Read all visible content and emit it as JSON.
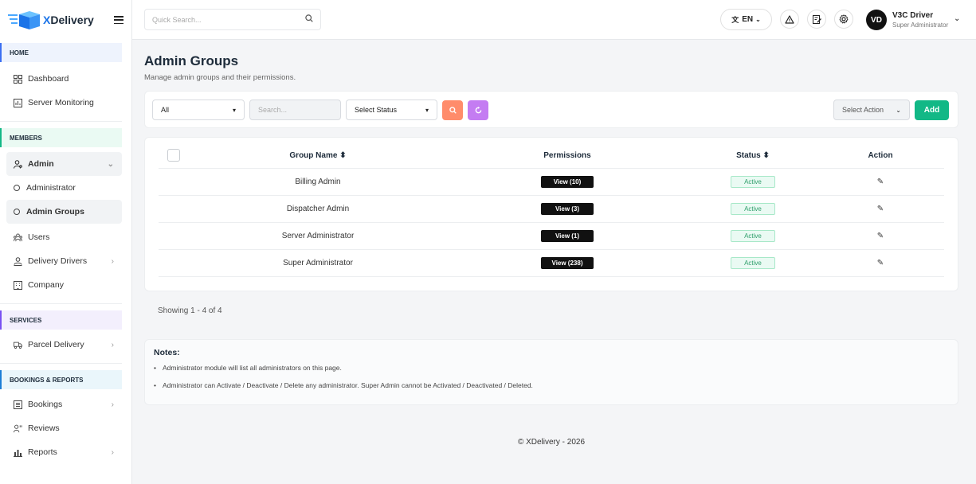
{
  "brand": {
    "name_prefix": "X",
    "name_rest": "Delivery"
  },
  "sidebar": {
    "sections": {
      "home": "HOME",
      "members": "MEMBERS",
      "services": "SERVICES",
      "bookings": "BOOKINGS & REPORTS"
    },
    "items": {
      "dashboard": "Dashboard",
      "server_monitoring": "Server Monitoring",
      "admin": "Admin",
      "administrator": "Administrator",
      "admin_groups": "Admin Groups",
      "users": "Users",
      "delivery_drivers": "Delivery Drivers",
      "company": "Company",
      "parcel_delivery": "Parcel Delivery",
      "bookings": "Bookings",
      "reviews": "Reviews",
      "reports": "Reports"
    }
  },
  "topbar": {
    "search_placeholder": "Quick Search...",
    "language": "EN",
    "avatar_initials": "VD",
    "user_name": "V3C Driver",
    "user_role": "Super Administrator"
  },
  "page": {
    "title": "Admin Groups",
    "subtitle": "Manage admin groups and their permissions."
  },
  "filters": {
    "scope_value": "All",
    "search_placeholder": "Search...",
    "status_value": "Select Status",
    "action_value": "Select Action",
    "add_label": "Add"
  },
  "table": {
    "headers": {
      "name": "Group Name",
      "permissions": "Permissions",
      "status": "Status",
      "action": "Action"
    },
    "rows": [
      {
        "name": "Billing Admin",
        "permissions": "View (10)",
        "status": "Active"
      },
      {
        "name": "Dispatcher Admin",
        "permissions": "View (3)",
        "status": "Active"
      },
      {
        "name": "Server Administrator",
        "permissions": "View (1)",
        "status": "Active"
      },
      {
        "name": "Super Administrator",
        "permissions": "View (238)",
        "status": "Active"
      }
    ]
  },
  "pagination": {
    "showing": "Showing 1 - 4 of 4"
  },
  "notes": {
    "title": "Notes:",
    "items": [
      "Administrator module will list all administrators on this page.",
      "Administrator can Activate / Deactivate / Delete any administrator. Super Admin cannot be Activated / Deactivated / Deleted."
    ]
  },
  "footer": {
    "text": "© XDelivery - 2026"
  },
  "colors": {
    "accent_green": "#12b886",
    "search_btn": "#ff8c6b",
    "refresh_btn": "#c47cf2",
    "brand_blue": "#1a73e8"
  },
  "icons": {
    "search": "search-icon",
    "language": "translate-icon",
    "alert": "warning-icon",
    "notes": "edit-note-icon",
    "settings": "gear-icon",
    "edit": "pencil-icon",
    "sort": "sort-icon"
  }
}
